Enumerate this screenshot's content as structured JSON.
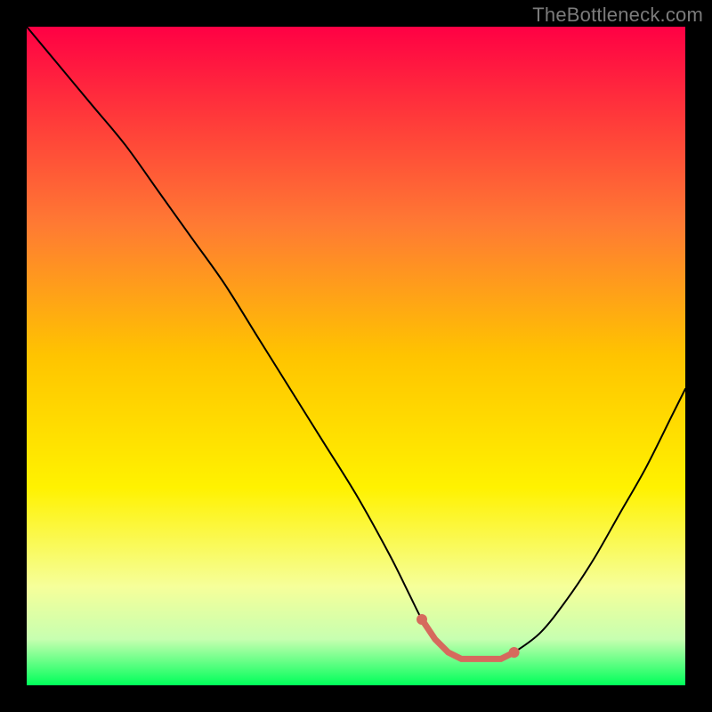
{
  "attribution": "TheBottleneck.com",
  "colors": {
    "page_bg": "#000000",
    "curve": "#000000",
    "marker": "#d66a5d",
    "gradient_stops": [
      {
        "offset": "0%",
        "color": "#ff0044"
      },
      {
        "offset": "14%",
        "color": "#ff3a3a"
      },
      {
        "offset": "30%",
        "color": "#ff7a33"
      },
      {
        "offset": "50%",
        "color": "#ffc400"
      },
      {
        "offset": "70%",
        "color": "#fff200"
      },
      {
        "offset": "85%",
        "color": "#f6ff9a"
      },
      {
        "offset": "93%",
        "color": "#c7ffb0"
      },
      {
        "offset": "100%",
        "color": "#00ff5a"
      }
    ]
  },
  "chart_data": {
    "type": "line",
    "title": "",
    "xlabel": "",
    "ylabel": "",
    "xlim": [
      0,
      100
    ],
    "ylim": [
      0,
      100
    ],
    "grid": false,
    "legend": false,
    "x": [
      0,
      5,
      10,
      15,
      20,
      25,
      30,
      35,
      40,
      45,
      50,
      55,
      58,
      60,
      62,
      64,
      66,
      68,
      70,
      72,
      74,
      78,
      82,
      86,
      90,
      94,
      98,
      100
    ],
    "values": [
      100,
      94,
      88,
      82,
      75,
      68,
      61,
      53,
      45,
      37,
      29,
      20,
      14,
      10,
      7,
      5,
      4,
      4,
      4,
      4,
      5,
      8,
      13,
      19,
      26,
      33,
      41,
      45
    ],
    "sweet_spot_x": [
      60,
      62,
      64,
      66,
      68,
      70,
      72,
      74
    ],
    "sweet_spot_y": [
      10,
      7,
      5,
      4,
      4,
      4,
      4,
      5
    ]
  }
}
